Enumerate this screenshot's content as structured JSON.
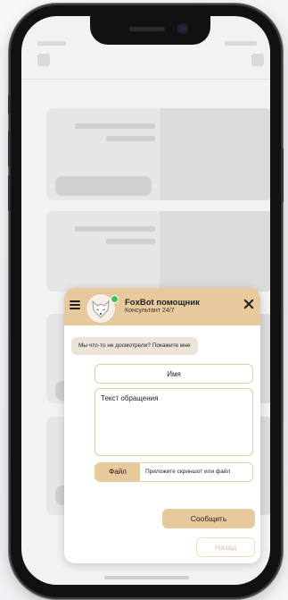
{
  "colors": {
    "accent": "#e8c99c",
    "bubble": "#ece4d9",
    "border": "#e4cda9",
    "online": "#35c759"
  },
  "chat": {
    "header": {
      "bot_name": "FoxBot помощник",
      "bot_status": "Консультант 24/7",
      "menu_icon": "hamburger-icon",
      "close_icon": "close-icon",
      "avatar_icon": "fox-icon"
    },
    "message": "Мы что-то не досмотрели? Покажите мне",
    "form": {
      "name_placeholder": "Имя",
      "message_placeholder": "Текст обращения",
      "file_button": "Файл",
      "file_hint": "Приложите скриншот или файл",
      "send_button": "Сообщить",
      "back_button": "Назад"
    }
  }
}
